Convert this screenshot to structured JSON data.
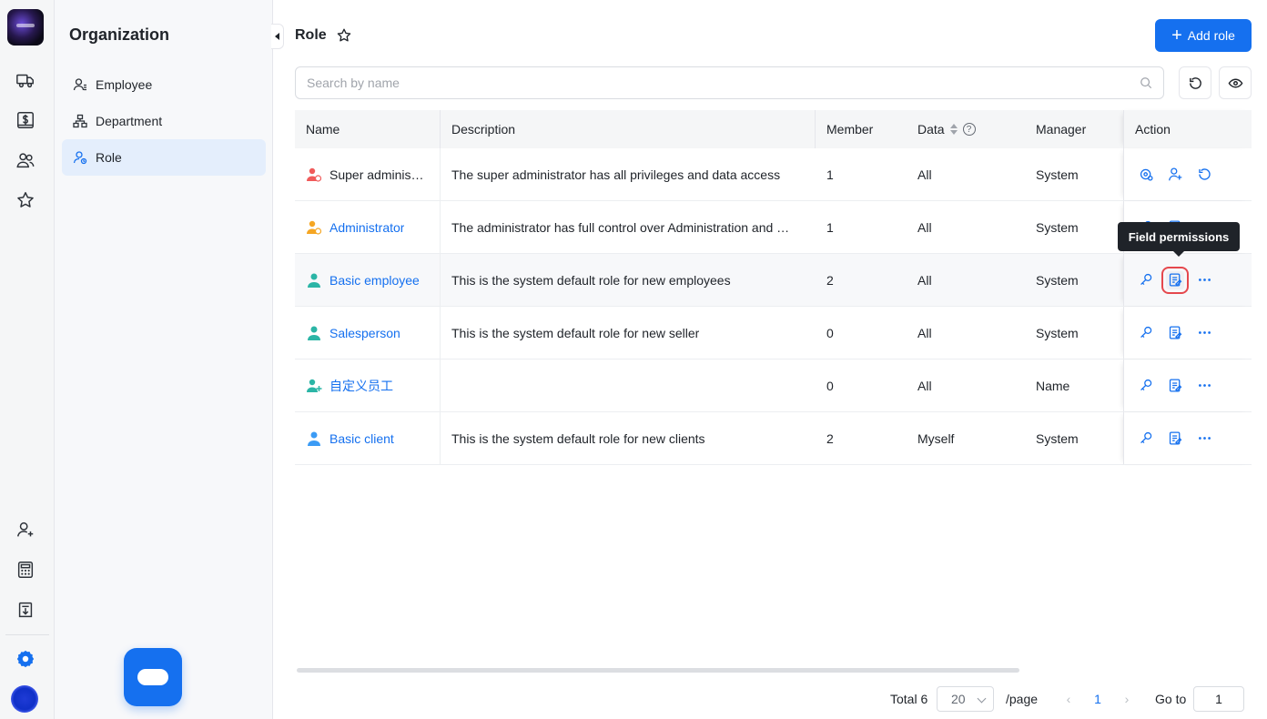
{
  "sidebar": {
    "title": "Organization",
    "items": [
      {
        "label": "Employee",
        "icon": "employee-icon"
      },
      {
        "label": "Department",
        "icon": "department-icon"
      },
      {
        "label": "Role",
        "icon": "role-icon",
        "active": true
      }
    ]
  },
  "rail_icons": [
    "truck-icon",
    "dollar-icon",
    "users-icon",
    "star-icon",
    "user-add-icon",
    "calculator-icon",
    "download-icon",
    "settings-icon"
  ],
  "header": {
    "title": "Role",
    "add_button": "Add role"
  },
  "search": {
    "placeholder": "Search by name",
    "value": ""
  },
  "table": {
    "columns": {
      "name": "Name",
      "description": "Description",
      "member": "Member",
      "data": "Data",
      "manager": "Manager",
      "action": "Action"
    },
    "rows": [
      {
        "name": "Super administ…",
        "description": "The super administrator has all privileges and data access",
        "member": "1",
        "data": "All",
        "manager": "System",
        "icon_color": "#f05a5a",
        "link": false
      },
      {
        "name": "Administrator",
        "description": "The administrator has full control over Administration and …",
        "member": "1",
        "data": "All",
        "manager": "System",
        "icon_color": "#f5a623",
        "link": true
      },
      {
        "name": "Basic employee",
        "description": "This is the system default role for new employees",
        "member": "2",
        "data": "All",
        "manager": "System",
        "icon_color": "#2bb5a6",
        "link": true
      },
      {
        "name": "Salesperson",
        "description": "This is the system default role for new seller",
        "member": "0",
        "data": "All",
        "manager": "System",
        "icon_color": "#2bb5a6",
        "link": true
      },
      {
        "name": "自定义员工",
        "description": "",
        "member": "0",
        "data": "All",
        "manager": "Name",
        "icon_color": "#2bb5a6",
        "link": true
      },
      {
        "name": "Basic client",
        "description": "This is the system default role for new clients",
        "member": "2",
        "data": "Myself",
        "manager": "System",
        "icon_color": "#3b9bf5",
        "link": true
      }
    ]
  },
  "tooltip": "Field permissions",
  "pagination": {
    "total": "Total 6",
    "page_size": "20",
    "per_page": "/page",
    "current": "1",
    "goto_label": "Go to",
    "goto_value": "1"
  },
  "colors": {
    "accent": "#1570ef",
    "highlight": "#e5484d"
  }
}
